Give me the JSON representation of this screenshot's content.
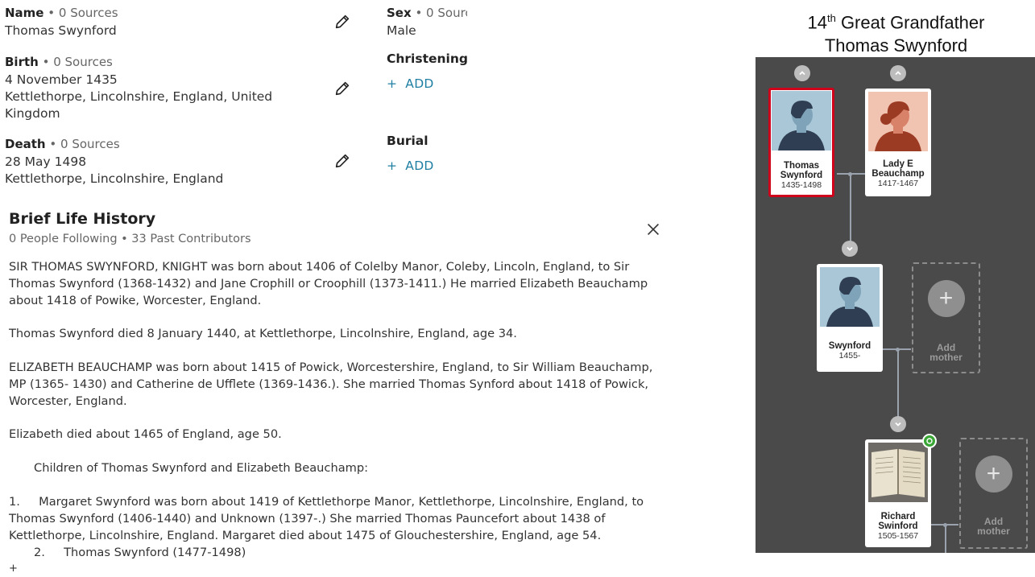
{
  "vitals": {
    "name": {
      "label": "Name",
      "sources": "• 0 Sources",
      "value": "Thomas Swynford"
    },
    "sex": {
      "label": "Sex",
      "sources": "• 0 Sourc",
      "value": "Male"
    },
    "birth": {
      "label": "Birth",
      "sources": "• 0 Sources",
      "date": "4 November 1435",
      "place": "Kettlethorpe, Lincolnshire, England, United Kingdom"
    },
    "christening": {
      "label": "Christening",
      "add": "ADD"
    },
    "death": {
      "label": "Death",
      "sources": "• 0 Sources",
      "date": "28 May 1498",
      "place": "Kettlethorpe, Lincolnshire, England"
    },
    "burial": {
      "label": "Burial",
      "add": "ADD"
    }
  },
  "history": {
    "title": "Brief Life History",
    "subtitle": "0 People Following • 33 Past Contributors",
    "paragraphs": [
      "SIR THOMAS SWYNFORD, KNIGHT was born about 1406 of Colelby Manor, Coleby, Lincoln, England, to Sir Thomas Swynford (1368-1432) and Jane Crophill or Croophill (1373-1411.) He married Elizabeth Beauchamp about 1418 of Powike, Worcester, England.",
      "Thomas Swynford died 8 January 1440, at Kettlethorpe, Lincolnshire, England, age 34.",
      "ELIZABETH BEAUCHAMP was born about 1415 of Powick, Worcestershire, England, to Sir William Beauchamp, MP (1365- 1430) and Catherine de Ufflete (1369-1436.). She married Thomas Synford about 1418 of Powick, Worcester, England.",
      "Elizabeth died about 1465 of England, age 50.",
      "Children of Thomas Swynford and Elizabeth Beauchamp:",
      "1.     Margaret Swynford was born about 1419 of Kettlethorpe Manor, Kettlethorpe, Lincolnshire, England, to Thomas Swynford (1406-1440) and Unknown (1397-.) She married Thomas Pauncefort about 1438 of Kettlethorpe, Lincolnshire, England. Margaret died about 1475 of Glouchestershire, England, age 54.",
      "2.     Thomas Swynford (1477-1498)",
      "+"
    ]
  },
  "tree": {
    "header_ordinal": "14",
    "header_sup": "th",
    "header_rest": " Great Grandfather",
    "header_name": "Thomas Swynford",
    "persons": [
      {
        "first": "Thomas",
        "last": "Swynford",
        "years": "1435-1498"
      },
      {
        "first": "Lady E",
        "last": "Beauchamp",
        "years": "1417-1467"
      },
      {
        "first": "Swynford",
        "last": "",
        "years": "1455-"
      },
      {
        "first": "Richard",
        "last": "Swinford",
        "years": "1505-1567"
      }
    ],
    "add_mother_1": "Add",
    "add_mother_2": "mother",
    "colors": {
      "panel": "#4a4a4a",
      "selected_border": "#d0021b",
      "link": "#1f7fa3"
    }
  }
}
